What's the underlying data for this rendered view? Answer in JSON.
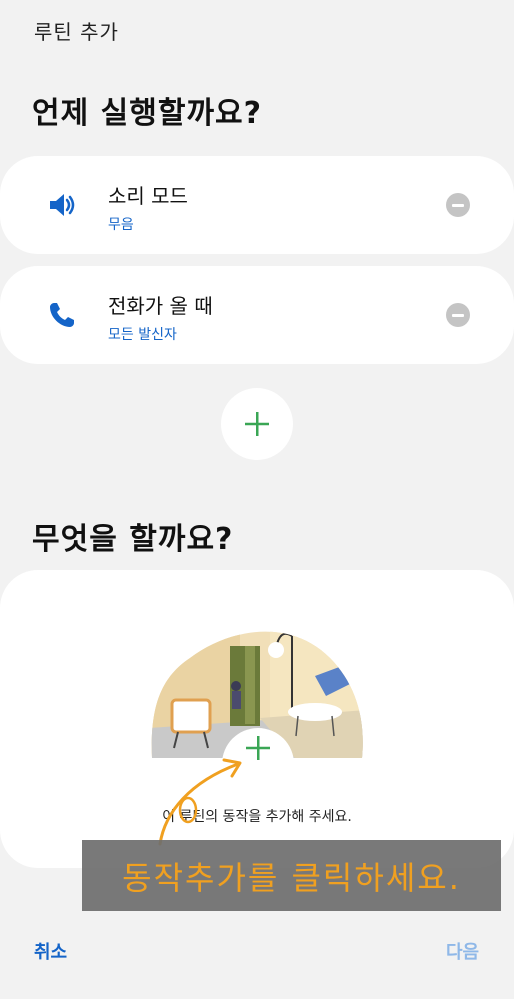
{
  "header": {
    "title": "루틴 추가"
  },
  "when": {
    "heading": "언제 실행할까요?",
    "conditions": [
      {
        "title": "소리 모드",
        "subtitle": "무음",
        "icon": "speaker-icon"
      },
      {
        "title": "전화가 올 때",
        "subtitle": "모든 발신자",
        "icon": "phone-icon"
      }
    ],
    "add_icon": "plus-icon"
  },
  "what": {
    "heading": "무엇을 할까요?",
    "empty_message": "이 루틴의 동작을 추가해 주세요.",
    "add_icon": "plus-icon"
  },
  "annotation": {
    "text": "동작추가를 클릭하세요."
  },
  "footer": {
    "cancel_label": "취소",
    "next_label": "다음"
  },
  "colors": {
    "background": "#f2f2f2",
    "card": "#ffffff",
    "accent_blue": "#1464c8",
    "plus_green": "#3aa655",
    "annotation_orange": "#f0a020",
    "next_disabled": "#8fb8e8"
  }
}
